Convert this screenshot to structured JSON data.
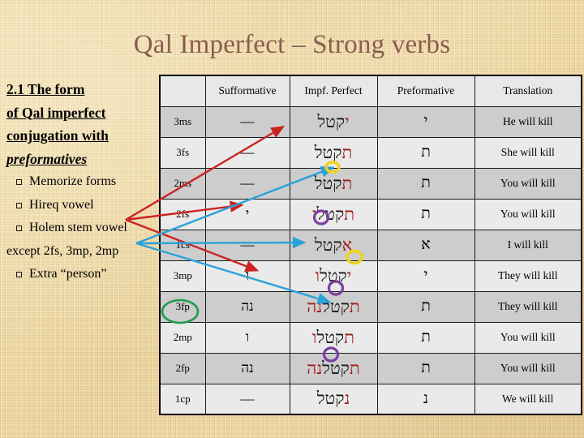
{
  "slide": {
    "title": "Qal Imperfect – Strong verbs",
    "title_color": "#8a5c50",
    "background_color": "#efd9a6"
  },
  "left_block": {
    "heading_lines": [
      "2.1  The form",
      "of Qal imperfect",
      "conjugation with",
      "preformatives"
    ],
    "bullets": [
      "Memorize forms",
      "Hireq vowel",
      "Holem stem vowel"
    ],
    "continuation": "except 2fs, 3mp, 2mp",
    "last_bullet": "Extra “person”",
    "bullet_glyph": "square-bullet"
  },
  "table": {
    "headers": [
      "",
      "Sufformative",
      "Impf. Perfect",
      "Preformative",
      "Translation"
    ],
    "rows": [
      {
        "person": "3ms",
        "sufformative": "—",
        "impf_pref": "י",
        "impf_stem": "קטל",
        "impf_suf": "",
        "preformative": "י",
        "translation": "He will kill",
        "shade": "dark"
      },
      {
        "person": "3fs",
        "sufformative": "—",
        "impf_pref": "ת",
        "impf_stem": "קטל",
        "impf_suf": "",
        "preformative": "ת",
        "translation": "She will kill",
        "shade": "light"
      },
      {
        "person": "2ms",
        "sufformative": "—",
        "impf_pref": "ת",
        "impf_stem": "קטל",
        "impf_suf": "",
        "preformative": "ת",
        "translation": "You will kill",
        "shade": "dark"
      },
      {
        "person": "2fs",
        "sufformative": "י",
        "impf_pref": "ת",
        "impf_stem": "קטל",
        "impf_suf": "י",
        "preformative": "ת",
        "translation": "You will kill",
        "shade": "light"
      },
      {
        "person": "1cs",
        "sufformative": "—",
        "impf_pref": "א",
        "impf_stem": "קטל",
        "impf_suf": "",
        "preformative": "א",
        "translation": "I will kill",
        "shade": "dark"
      },
      {
        "person": "3mp",
        "sufformative": "ו",
        "impf_pref": "י",
        "impf_stem": "קטל",
        "impf_suf": "ו",
        "preformative": "י",
        "translation": "They will kill",
        "shade": "light"
      },
      {
        "person": "3fp",
        "sufformative": "נה",
        "impf_pref": "ת",
        "impf_stem": "קטל",
        "impf_suf": "נה",
        "preformative": "ת",
        "translation": "They will kill",
        "shade": "dark"
      },
      {
        "person": "2mp",
        "sufformative": "ו",
        "impf_pref": "ת",
        "impf_stem": "קטל",
        "impf_suf": "ו",
        "preformative": "ת",
        "translation": "You will kill",
        "shade": "light"
      },
      {
        "person": "2fp",
        "sufformative": "נה",
        "impf_pref": "ת",
        "impf_stem": "קטל",
        "impf_suf": "נה",
        "preformative": "ת",
        "translation": "You will kill",
        "shade": "dark"
      },
      {
        "person": "1cp",
        "sufformative": "—",
        "impf_pref": "נ",
        "impf_stem": "קטל",
        "impf_suf": "",
        "preformative": "נ",
        "translation": "We will kill",
        "shade": "light"
      }
    ]
  },
  "annotations": {
    "red_arrow_color": "#cc2222",
    "blue_arrow_color": "#2aa3d8",
    "green_circle_color": "#1f9a4d",
    "yellow_circle_color": "#f2d218",
    "purple_circle_color": "#7b3fa0",
    "green_circled_label": "3fp",
    "yellow_circled_items": [
      "2ms-holem",
      "1cs-aleph"
    ],
    "purple_circled_items": [
      "2fs-stem",
      "3mp-stem",
      "2mp-stem"
    ]
  }
}
